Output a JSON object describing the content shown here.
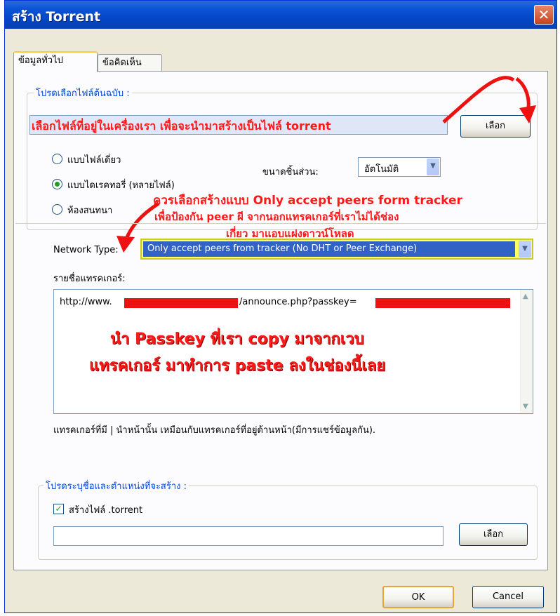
{
  "window": {
    "title": "สร้าง Torrent",
    "close_label": "✕"
  },
  "tabs": [
    {
      "label": "ข้อมูลทั่วไป"
    },
    {
      "label": "ข้อคิดเห็น"
    }
  ],
  "source_group": {
    "legend": "โปรดเลือกไฟล์ต้นฉบับ :",
    "source_field_value": "เลือกไฟล์ที่อยู่ในเครื่องเรา เพื่อจะนำมาสร้างเป็นไฟล์ torrent",
    "choose_label": "เลือก",
    "radio_single": "แบบไฟล์เดี่ยว",
    "radio_directory": "แบบไดเรคทอรี่ (หลายไฟล์)",
    "radio_third": "ห้องสนทนา",
    "piece_size_label": "ขนาดชิ้นส่วน:",
    "piece_size_value": "อัตโนมัติ"
  },
  "annotation_network": {
    "line1": "ควรเลือกสร้างแบบ Only accept peers form tracker",
    "line2": "เพื่อป้องกัน peer ผี จากนอกแทรคเกอร์ที่เราไม่ได้ช่อง",
    "line3": "เกี่ยว มาแอบแฝงดาวน์โหลด"
  },
  "network": {
    "label": "Network Type:",
    "value": "Only accept peers from tracker (No DHT or Peer Exchange)"
  },
  "tracker": {
    "label": "รายชื่อแทรคเกอร์:",
    "url_prefix": "http://www.",
    "url_middle": "/announce.php?passkey=",
    "note_line1": "นำ Passkey ที่เรา copy มาจากเวบ",
    "note_line2": "แทรคเกอร์ มาทำการ paste ลงในช่องนี้เลย",
    "hint": "แทรคเกอร์ที่มี | นำหน้านั้น เหมือนกับแทรคเกอร์ที่อยู่ด้านหน้า(มีการแชร์ข้อมูลกัน)."
  },
  "dest_group": {
    "legend": "โปรดระบุชื่อและตำแหน่งที่จะสร้าง :",
    "checkbox_label": "สร้างไฟล์ .torrent",
    "path_value": "",
    "choose_label": "เลือก"
  },
  "footer": {
    "ok_label": "OK",
    "cancel_label": "Cancel"
  },
  "colors": {
    "annotation_red": "#ff1a1a",
    "titlebar_blue": "#0a53d6",
    "highlight_yellow": "#ffff66"
  }
}
